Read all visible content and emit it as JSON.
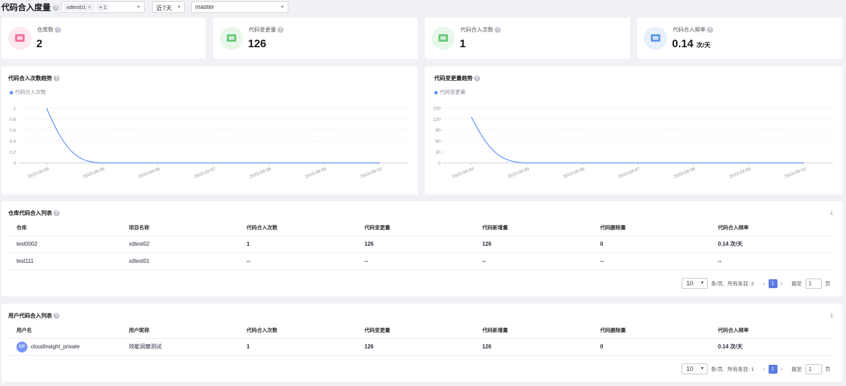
{
  "header": {
    "title": "代码合入度量",
    "filter_tags": [
      "xdtest01",
      "+ 1"
    ],
    "period": "近7天",
    "branch": "master"
  },
  "stats": [
    {
      "label": "仓库数",
      "value": "2",
      "unit": "",
      "icon": "repo-icon",
      "color": "#f25c8f"
    },
    {
      "label": "代码变更量",
      "value": "126",
      "unit": "",
      "icon": "code-change-icon",
      "color": "#57c26b"
    },
    {
      "label": "代码合入次数",
      "value": "1",
      "unit": "",
      "icon": "merge-count-icon",
      "color": "#57c26b"
    },
    {
      "label": "代码合入频率",
      "value": "0.14",
      "unit": "次/天",
      "icon": "merge-frequency-icon",
      "color": "#4a90e8"
    }
  ],
  "charts": {
    "merge_trend": {
      "title": "代码合入次数趋势",
      "legend": "代码合入次数"
    },
    "change_trend": {
      "title": "代码变更量趋势",
      "legend": "代码变更量"
    }
  },
  "chart_data": [
    {
      "type": "line",
      "title": "代码合入次数趋势",
      "x": [
        "2023-04-04",
        "2023-04-05",
        "2023-04-06",
        "2023-04-07",
        "2023-04-08",
        "2023-04-09",
        "2023-04-10"
      ],
      "series": [
        {
          "name": "代码合入次数",
          "values": [
            1,
            0,
            0,
            0,
            0,
            0,
            0
          ]
        }
      ],
      "yticks": [
        "0",
        "0.2",
        "0.4",
        "0.6",
        "0.8",
        "1"
      ],
      "ylim": [
        0,
        1
      ],
      "color": "#5b8ff9",
      "grid": true,
      "legend": "top-left"
    },
    {
      "type": "line",
      "title": "代码变更量趋势",
      "x": [
        "2023-04-04",
        "2023-04-05",
        "2023-04-06",
        "2023-04-07",
        "2023-04-08",
        "2023-04-09",
        "2023-04-10"
      ],
      "series": [
        {
          "name": "代码变更量",
          "values": [
            126,
            0,
            0,
            0,
            0,
            0,
            0
          ]
        }
      ],
      "yticks": [
        "0",
        "30",
        "60",
        "90",
        "120",
        "150"
      ],
      "ylim": [
        0,
        150
      ],
      "color": "#5b8ff9",
      "grid": true,
      "legend": "top-left"
    }
  ],
  "repo_table": {
    "title": "仓库代码合入列表",
    "columns": [
      "仓库",
      "项目名称",
      "代码合入次数",
      "代码变更量",
      "代码新增量",
      "代码删除量",
      "代码合入频率"
    ],
    "rows": [
      [
        "test0002",
        "xdtest02",
        "1",
        "126",
        "126",
        "0",
        "0.14 次/天"
      ],
      [
        "test111",
        "xdtest01",
        "--",
        "--",
        "--",
        "--",
        "--"
      ]
    ],
    "pager": {
      "size": "10",
      "per_page": "条/页,",
      "total": "所有条目: 2",
      "page": "1",
      "jump": "跳至",
      "jump_value": "1",
      "page_unit": "页"
    }
  },
  "user_table": {
    "title": "用户代码合入列表",
    "columns": [
      "用户名",
      "用户昵称",
      "代码合入次数",
      "代码变更量",
      "代码新增量",
      "代码删除量",
      "代码合入频率"
    ],
    "rows": [
      {
        "avatar": "CP",
        "cells": [
          "cloudInsight_private",
          "效能洞察测试",
          "1",
          "126",
          "126",
          "0",
          "0.14 次/天"
        ]
      }
    ],
    "pager": {
      "size": "10",
      "per_page": "条/页,",
      "total": "所有条目: 1",
      "page": "1",
      "jump": "跳至",
      "jump_value": "1",
      "page_unit": "页"
    }
  }
}
